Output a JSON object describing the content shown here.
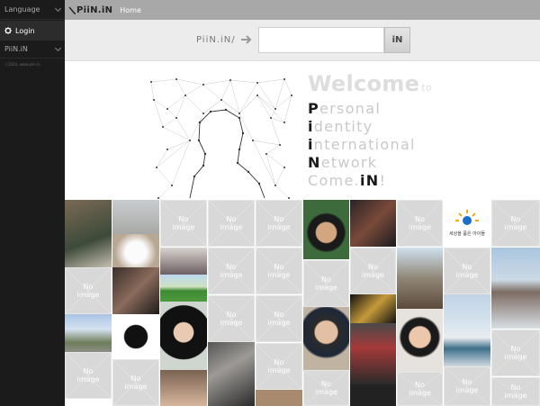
{
  "sidebar": {
    "language_label": "Language",
    "login_label": "Login",
    "piin_label": "PiiN.iN",
    "copyright": "ⓒ2024, www.piin.in"
  },
  "topbar": {
    "logo_text": "PiiN.iN",
    "home_label": "Home"
  },
  "search": {
    "prefix_label": "PiiN.iN/",
    "value": "",
    "placeholder": "",
    "button_label": "iN"
  },
  "hero": {
    "welcome": "Welcome",
    "welcome_to": "to",
    "acronym": [
      {
        "initial": "P",
        "rest": "ersonal"
      },
      {
        "initial": "i",
        "rest": "dentity"
      },
      {
        "initial": "i",
        "rest": "nternational"
      },
      {
        "initial": "N",
        "rest": "etwork"
      },
      {
        "initial": "",
        "rest": "Come."
      }
    ],
    "come_in_bold": "iN",
    "come_in_end": "!"
  },
  "grid": {
    "no_image_label": "No image",
    "kids_logo_text": "세상을 품은 아이들"
  },
  "colors": {
    "sidebar_bg": "#1b1b1b",
    "topbar_bg": "#a8a8a8",
    "searchbar_bg": "#ececec",
    "placeholder_tile": "#d8d8d8"
  }
}
